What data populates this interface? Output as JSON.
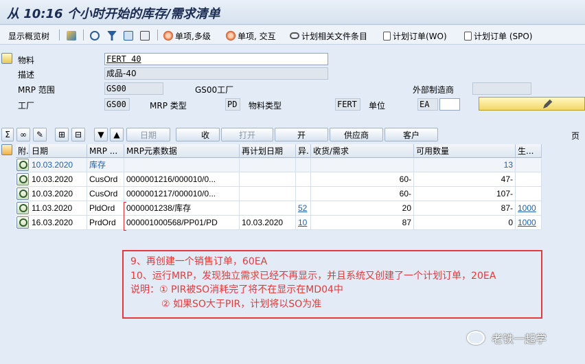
{
  "title": "从 10:16 个小时开始的库存/需求清单",
  "toolbar": {
    "overview_tree": "显示概览树",
    "single_multi": "单项,多级",
    "single_interactive": "单项, 交互",
    "plan_file": "计划相关文件条目",
    "planned_order_wo": "计划订单(WO)",
    "planned_order_spo": "计划订单 (SPO)"
  },
  "header": {
    "material_label": "物料",
    "material_value": "FERT 40",
    "desc_label": "描述",
    "desc_value": "成品-40",
    "mrp_area_label": "MRP 范围",
    "mrp_area_value": "GS00",
    "mrp_area_text": "GS00工厂",
    "ext_mfr_label": "外部制造商",
    "plant_label": "工厂",
    "plant_value": "GS00",
    "mrp_type_label": "MRP 类型",
    "mrp_type_value": "PD",
    "mat_type_label": "物料类型",
    "mat_type_value": "FERT",
    "unit_label": "单位",
    "unit_value": "EA"
  },
  "grid_toolbar": {
    "date_btn": "日期",
    "receipt_btn": "收",
    "open_btn": "打开",
    "open2_btn": "开",
    "vendor_btn": "供应商",
    "customer_btn": "客户",
    "page_label": "页"
  },
  "table": {
    "columns": [
      "附.",
      "日期",
      "MRP ...",
      "MRP元素数据",
      "再计划日期",
      "异.",
      "收货/需求",
      "可用数量",
      "生..."
    ],
    "rows": [
      {
        "date": "10.03.2020",
        "mrp": "库存",
        "data": "",
        "resched": "",
        "exc": "",
        "qty": "",
        "avail": "13",
        "prod": ""
      },
      {
        "date": "10.03.2020",
        "mrp": "CusOrd",
        "data": "0000001216/000010/0...",
        "resched": "",
        "exc": "",
        "qty": "60-",
        "avail": "47-",
        "prod": ""
      },
      {
        "date": "10.03.2020",
        "mrp": "CusOrd",
        "data": "0000001217/000010/0...",
        "resched": "",
        "exc": "",
        "qty": "60-",
        "avail": "107-",
        "prod": ""
      },
      {
        "date": "11.03.2020",
        "mrp": "PldOrd",
        "data": "0000001238/库存",
        "resched": "",
        "exc": "52",
        "qty": "20",
        "avail": "87-",
        "prod": "1000"
      },
      {
        "date": "16.03.2020",
        "mrp": "PrdOrd",
        "data": "000001000568/PP01/PD",
        "resched": "10.03.2020",
        "exc": "10",
        "qty": "87",
        "avail": "0",
        "prod": "1000"
      }
    ]
  },
  "note": {
    "line1": "9、再创建一个销售订单，60EA",
    "line2": "10、运行MRP，发现独立需求已经不再显示，并且系统又创建了一个计划订单，20EA",
    "line3": "说明：① PIR被SO消耗完了将不在显示在MD04中",
    "line4": "② 如果SO大于PIR，计划将以SO为准"
  },
  "watermark": "老铁一起学",
  "colors": {
    "accent": "#1f5fb0",
    "annotation": "#e23a3a",
    "title": "#1b2b52"
  }
}
